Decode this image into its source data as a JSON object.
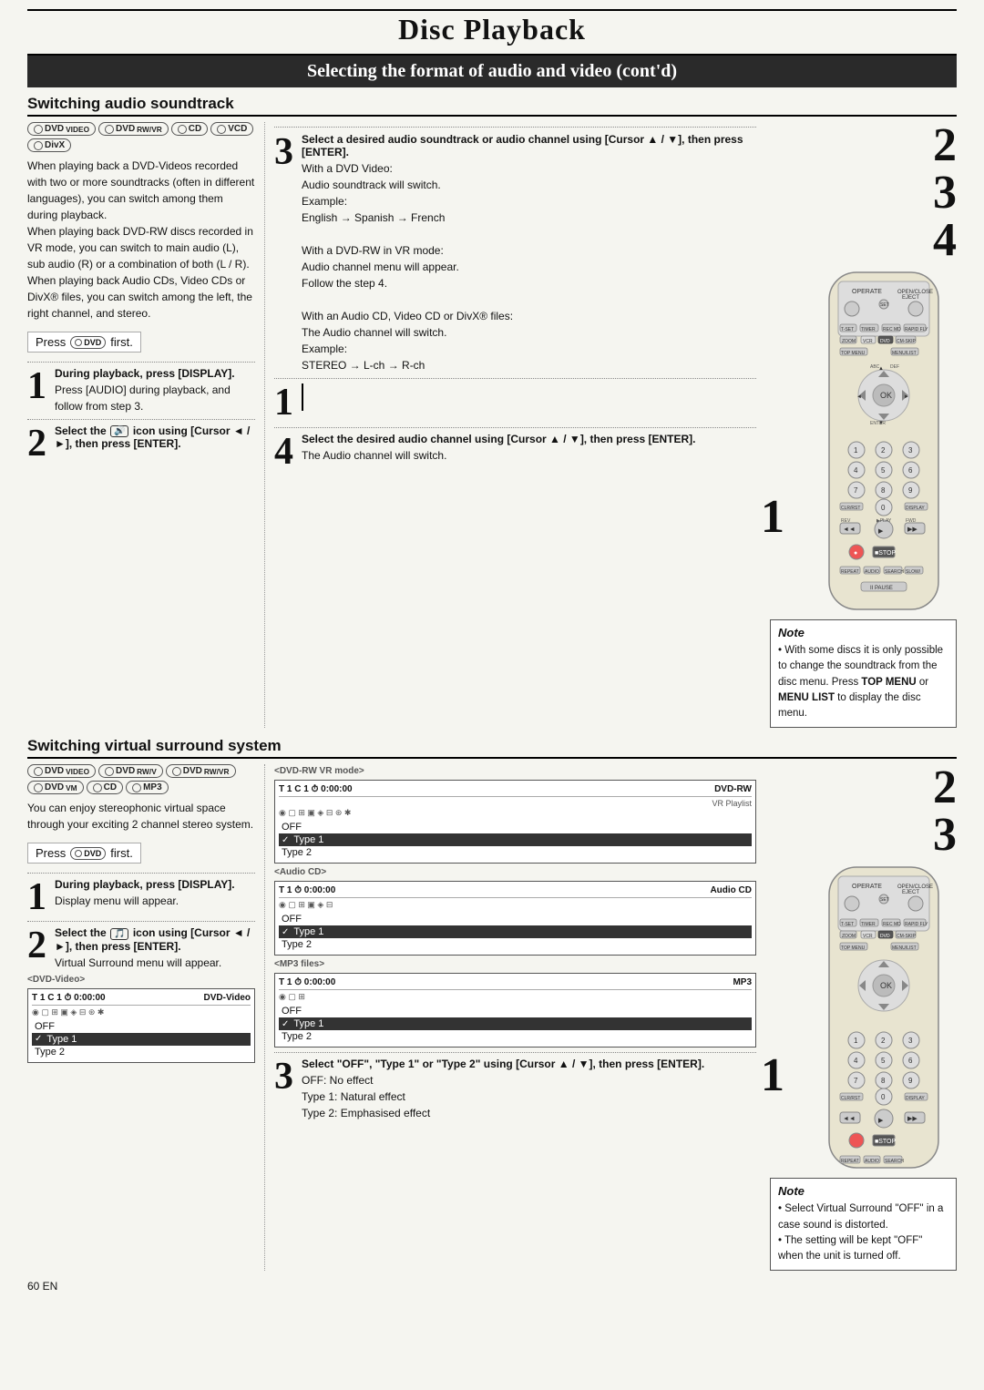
{
  "page": {
    "title": "Disc Playback",
    "subtitle": "Selecting the format of audio and video (cont'd)",
    "page_number": "60  EN"
  },
  "section1": {
    "heading": "Switching audio soundtrack",
    "disc_icons": [
      "DVD VIDEO",
      "DVD RW/VR MODE",
      "CD",
      "VCD",
      "DivX"
    ],
    "body_text": "When playing back a DVD-Videos recorded with two or more soundtracks (often in different languages), you can switch among them during playback.\nWhen playing back DVD-RW discs recorded in VR mode, you can switch to main audio (L), sub audio (R) or a combination of both (L / R).\nWhen playing back Audio CDs, Video CDs or DivX® files, you can switch among the left, the right channel, and stereo.",
    "press_first": "Press",
    "press_first_suffix": "first.",
    "step1_heading": "During playback, press [DISPLAY].",
    "step1_body": "Press [AUDIO] during playback, and follow from step 3.",
    "step2_heading": "Select the",
    "step2_heading2": "icon using [Cursor ◄ / ►], then press [ENTER].",
    "step3_heading": "Select a desired audio soundtrack or audio channel using [Cursor ▲ / ▼], then press [ENTER].",
    "step3_body1": "With a DVD Video:",
    "step3_body2": "Audio soundtrack will switch.",
    "step3_body3": "Example:",
    "step3_body4": "English → Spanish → French",
    "step3_body5": "With a DVD-RW in VR mode:",
    "step3_body6": "Audio channel menu will appear.",
    "step3_body7": "Follow the step 4.",
    "step3_body8": "With an Audio CD, Video CD or DivX® files:",
    "step3_body9": "The Audio channel will switch.",
    "step3_body10": "Example:",
    "step3_body11": "STEREO → L-ch → R-ch",
    "step4_heading": "Select the desired audio channel using [Cursor ▲ / ▼], then press [ENTER].",
    "step4_body": "The Audio channel will switch.",
    "note1_title": "Note",
    "note1_body": "• With some discs it is only possible to change the soundtrack from the disc menu. Press TOP MENU or MENU LIST to display the disc menu.",
    "right_steps": [
      "2",
      "3",
      "4",
      "1"
    ]
  },
  "section2": {
    "heading": "Switching virtual surround system",
    "disc_icons": [
      "DVD VIDEO MODE",
      "DVD RW/VIDEO MODE",
      "DVD RW/VR MODE",
      "DVD VIDEO MODE",
      "CD",
      "MP3"
    ],
    "body_text": "You can enjoy stereophonic virtual space through your exciting 2 channel stereo system.",
    "press_first": "Press",
    "press_first_suffix": "first.",
    "step1_heading": "During playback, press [DISPLAY].",
    "step1_body": "Display menu will appear.",
    "step2_heading": "Select the",
    "step2_heading2": "icon using [Cursor ◄ / ►], then press [ENTER].",
    "step2_body": "Virtual Surround menu will appear.",
    "screen_dvd_video_label": "<DVD-Video>",
    "screen_dvd_rw_label": "<DVD-RW VR mode>",
    "screen_audio_cd_label": "<Audio CD>",
    "screen_mp3_label": "<MP3 files>",
    "screen_dvd_video": {
      "header_left": "T 1  C 1  ⏱ 0:00:00",
      "header_right": "DVD-Video",
      "icons": "⊕◫⊞▣◈⊟⊛",
      "menu_items": [
        "OFF",
        "Type 1",
        "Type 2"
      ],
      "selected": 1
    },
    "screen_dvdrw_vr": {
      "header_left": "T 1  C 1  ⏱ 0:00:00",
      "header_right": "DVD-RW",
      "sub": "VR Playlist",
      "icons": "⊕◫⊞▣◈⊟⊛",
      "menu_items": [
        "OFF",
        "Type 1",
        "Type 2"
      ],
      "selected": 1
    },
    "screen_audio_cd": {
      "header_left": "T 1  ⏱ 0:00:00",
      "header_right": "Audio CD",
      "icons": "⊕◫⊞▣◈⊟",
      "menu_items": [
        "OFF",
        "Type 1",
        "Type 2"
      ],
      "selected": 1
    },
    "screen_mp3": {
      "header_left": "T 1  ⏱ 0:00:00",
      "header_right": "MP3",
      "icons": "⊕◫⊞",
      "menu_items": [
        "OFF",
        "Type 1",
        "Type 2"
      ],
      "selected": 1
    },
    "step3_heading": "Select \"OFF\", \"Type 1\" or \"Type 2\" using [Cursor ▲ / ▼], then press [ENTER].",
    "step3_off": "OFF:     No effect",
    "step3_type1": "Type 1:  Natural effect",
    "step3_type2": "Type 2:  Emphasised effect",
    "note2_title": "Note",
    "note2_body1": "• Select Virtual Surround \"OFF\" in a case sound is distorted.",
    "note2_body2": "• The setting will be kept \"OFF\" when the unit is turned off.",
    "right_steps": [
      "2",
      "3",
      "1"
    ]
  }
}
